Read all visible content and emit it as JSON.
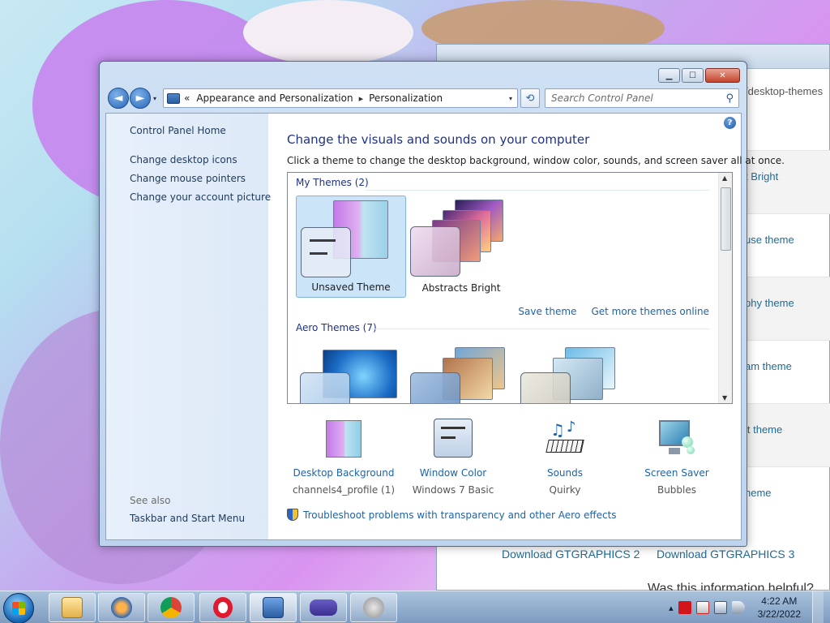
{
  "background_window": {
    "address_fragment": "/desktop-themes",
    "rows": [
      "t Bright",
      "use theme",
      "phy theme",
      "am theme",
      "it theme",
      "heme"
    ],
    "download1": "Download GTGRAPHICS 2",
    "download2": "Download GTGRAPHICS 3",
    "helpful": "Was this information helpful?"
  },
  "window": {
    "caption": {
      "minimize": "▁",
      "maximize": "☐",
      "close": "✕"
    },
    "nav": {
      "back": "◄",
      "forward": "►",
      "history_arrow": "▾"
    },
    "address": {
      "chevrons": "«",
      "crumb1": "Appearance and Personalization",
      "separator": "▸",
      "crumb2": "Personalization",
      "dropdown": "▾"
    },
    "refresh": "⟲",
    "search": {
      "placeholder": "Search Control Panel",
      "icon": "⚲"
    }
  },
  "left_pane": {
    "home": "Control Panel Home",
    "links": [
      "Change desktop icons",
      "Change mouse pointers",
      "Change your account picture"
    ],
    "see_also": "See also",
    "see_also_link": "Taskbar and Start Menu"
  },
  "main": {
    "help": "?",
    "heading": "Change the visuals and sounds on your computer",
    "description": "Click a theme to change the desktop background, window color, sounds, and screen saver all at once.",
    "my_themes_header": "My Themes (2)",
    "my_themes": [
      {
        "label": "Unsaved Theme",
        "selected": true
      },
      {
        "label": "Abstracts Bright",
        "selected": false
      }
    ],
    "save_theme": "Save theme",
    "get_more": "Get more themes online",
    "aero_header": "Aero Themes (7)",
    "bottom": [
      {
        "title": "Desktop Background",
        "subtitle": "channels4_profile (1)",
        "icon": "desktop-background-icon"
      },
      {
        "title": "Window Color",
        "subtitle": "Windows 7 Basic",
        "icon": "window-color-icon"
      },
      {
        "title": "Sounds",
        "subtitle": "Quirky",
        "icon": "sounds-icon"
      },
      {
        "title": "Screen Saver",
        "subtitle": "Bubbles",
        "icon": "screen-saver-icon"
      }
    ],
    "troubleshoot": "Troubleshoot problems with transparency and other Aero effects"
  },
  "taskbar": {
    "time": "4:22 AM",
    "date": "3/22/2022",
    "tray_arrow": "▴",
    "pinned": [
      "explorer-icon",
      "media-player-icon",
      "chrome-icon",
      "opera-icon",
      "control-panel-icon",
      "gba-icon",
      "speaker-icon"
    ]
  }
}
